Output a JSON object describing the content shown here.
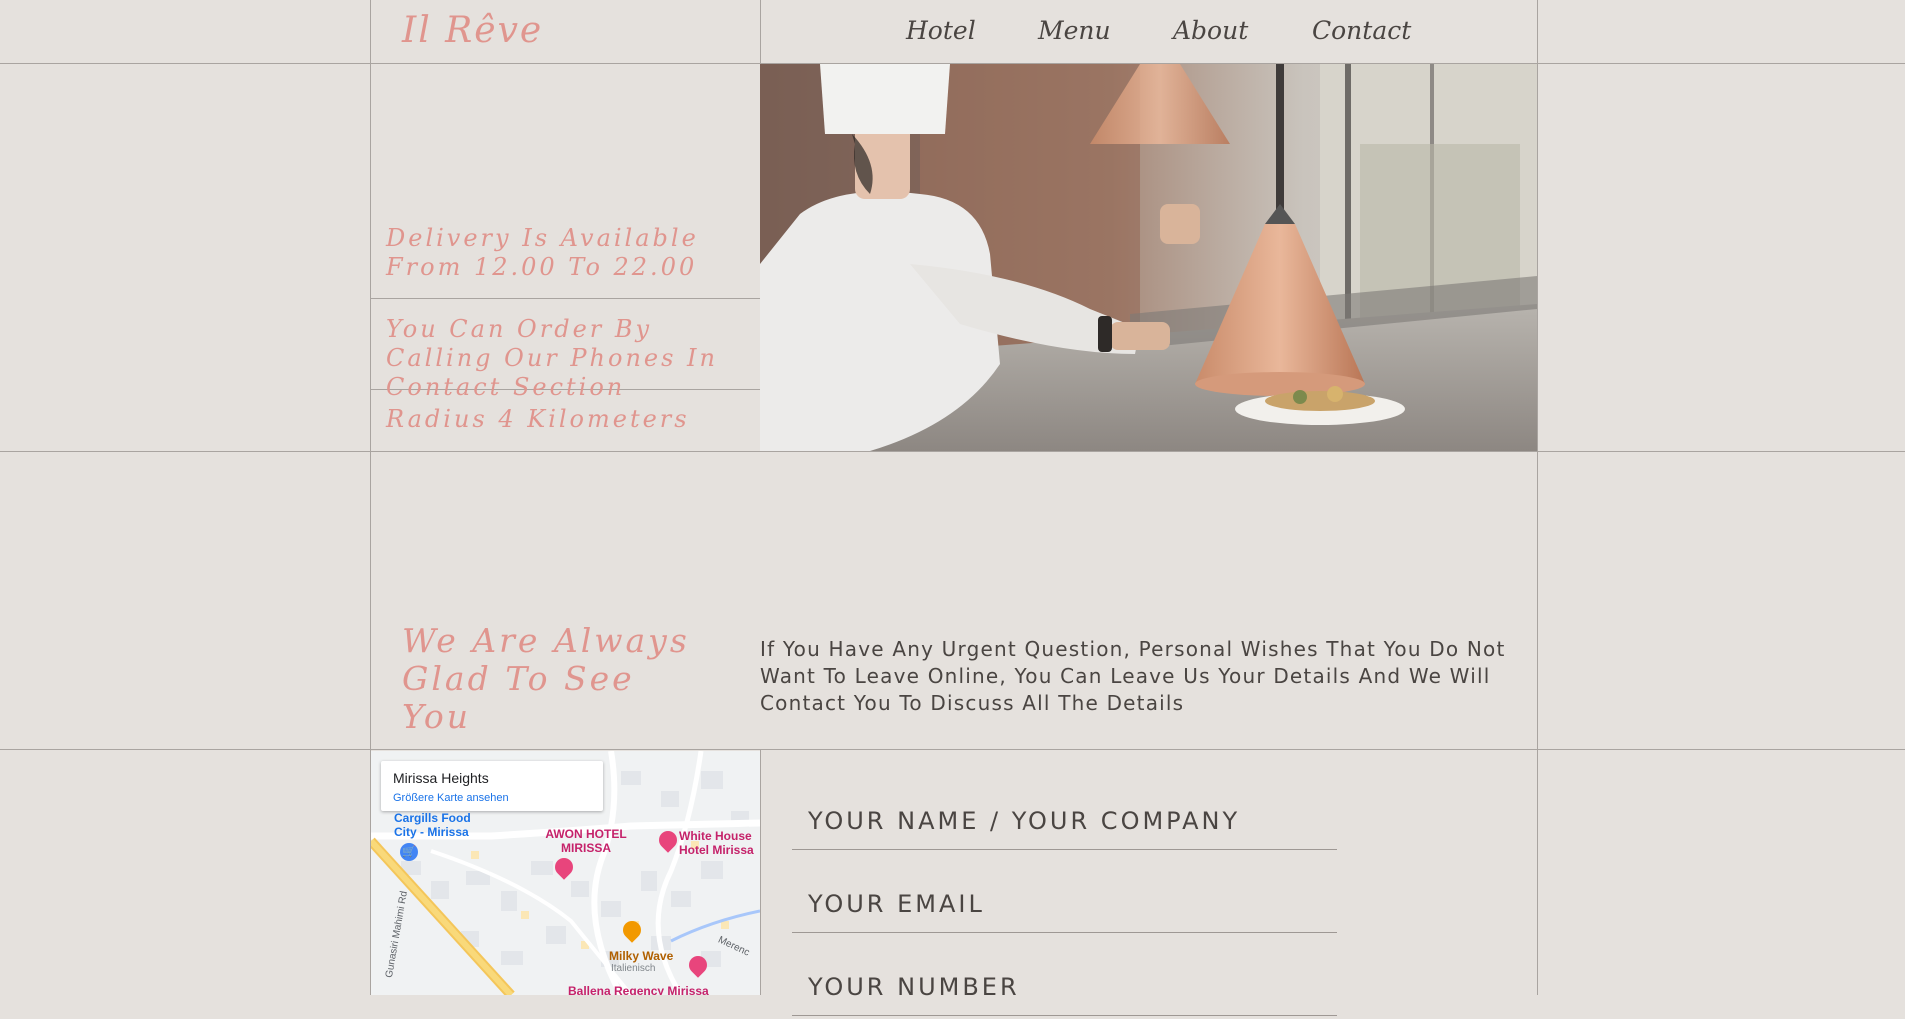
{
  "header": {
    "logo": "Il Rêve",
    "nav": [
      "Hotel",
      "Menu",
      "About",
      "Contact"
    ]
  },
  "delivery": {
    "items": [
      "Delivery Is Available From 12.00 To 22.00",
      "You Can Order By Calling Our Phones In Contact Section",
      "Radius 4 Kilometers"
    ]
  },
  "contact_intro": {
    "heading": "We Are Always Glad To See You",
    "text": "If You Have Any Urgent Question, Personal Wishes That You Do Not Want To Leave Online, You Can Leave Us Your Details And We Will Contact You To Discuss All The Details"
  },
  "map": {
    "place_name": "Mirissa Heights",
    "larger_map_link": "Größere Karte ansehen",
    "labels": {
      "cargills": "Cargills Food City - Mirissa",
      "awon": "AWON HOTEL MIRISSA",
      "white_house": "White House Hotel Mirissa",
      "milky_wave": "Milky Wave",
      "milky_wave_sub": "Italienisch",
      "ballena": "Ballena Regency Mirissa",
      "road_mahimi": "Gunasiri Mahimi Rd",
      "road_merenc": "Merenc"
    }
  },
  "form": {
    "name_placeholder": "YOUR NAME / YOUR COMPANY",
    "email_placeholder": "YOUR EMAIL",
    "number_placeholder": "YOUR NUMBER"
  },
  "colors": {
    "background": "#e5e1dd",
    "accent_pink": "#e0958e",
    "text_dark": "#4a4542",
    "grid_line": "#a9a4a0"
  }
}
